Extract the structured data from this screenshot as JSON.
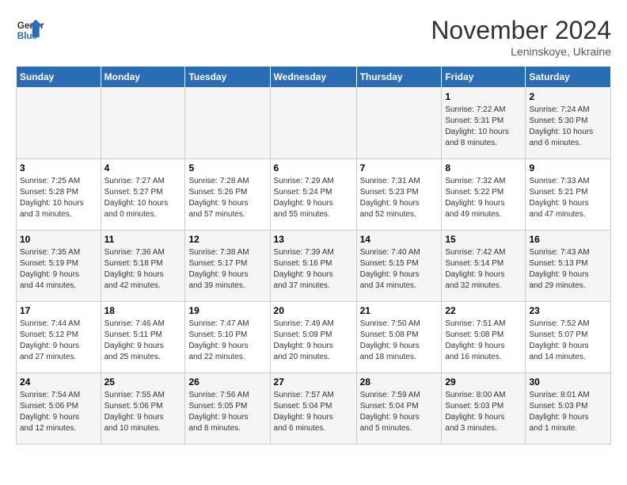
{
  "header": {
    "logo_text1": "General",
    "logo_text2": "Blue",
    "month": "November 2024",
    "location": "Leninskoye, Ukraine"
  },
  "weekdays": [
    "Sunday",
    "Monday",
    "Tuesday",
    "Wednesday",
    "Thursday",
    "Friday",
    "Saturday"
  ],
  "weeks": [
    [
      {
        "day": "",
        "info": ""
      },
      {
        "day": "",
        "info": ""
      },
      {
        "day": "",
        "info": ""
      },
      {
        "day": "",
        "info": ""
      },
      {
        "day": "",
        "info": ""
      },
      {
        "day": "1",
        "info": "Sunrise: 7:22 AM\nSunset: 5:31 PM\nDaylight: 10 hours\nand 8 minutes."
      },
      {
        "day": "2",
        "info": "Sunrise: 7:24 AM\nSunset: 5:30 PM\nDaylight: 10 hours\nand 6 minutes."
      }
    ],
    [
      {
        "day": "3",
        "info": "Sunrise: 7:25 AM\nSunset: 5:28 PM\nDaylight: 10 hours\nand 3 minutes."
      },
      {
        "day": "4",
        "info": "Sunrise: 7:27 AM\nSunset: 5:27 PM\nDaylight: 10 hours\nand 0 minutes."
      },
      {
        "day": "5",
        "info": "Sunrise: 7:28 AM\nSunset: 5:26 PM\nDaylight: 9 hours\nand 57 minutes."
      },
      {
        "day": "6",
        "info": "Sunrise: 7:29 AM\nSunset: 5:24 PM\nDaylight: 9 hours\nand 55 minutes."
      },
      {
        "day": "7",
        "info": "Sunrise: 7:31 AM\nSunset: 5:23 PM\nDaylight: 9 hours\nand 52 minutes."
      },
      {
        "day": "8",
        "info": "Sunrise: 7:32 AM\nSunset: 5:22 PM\nDaylight: 9 hours\nand 49 minutes."
      },
      {
        "day": "9",
        "info": "Sunrise: 7:33 AM\nSunset: 5:21 PM\nDaylight: 9 hours\nand 47 minutes."
      }
    ],
    [
      {
        "day": "10",
        "info": "Sunrise: 7:35 AM\nSunset: 5:19 PM\nDaylight: 9 hours\nand 44 minutes."
      },
      {
        "day": "11",
        "info": "Sunrise: 7:36 AM\nSunset: 5:18 PM\nDaylight: 9 hours\nand 42 minutes."
      },
      {
        "day": "12",
        "info": "Sunrise: 7:38 AM\nSunset: 5:17 PM\nDaylight: 9 hours\nand 39 minutes."
      },
      {
        "day": "13",
        "info": "Sunrise: 7:39 AM\nSunset: 5:16 PM\nDaylight: 9 hours\nand 37 minutes."
      },
      {
        "day": "14",
        "info": "Sunrise: 7:40 AM\nSunset: 5:15 PM\nDaylight: 9 hours\nand 34 minutes."
      },
      {
        "day": "15",
        "info": "Sunrise: 7:42 AM\nSunset: 5:14 PM\nDaylight: 9 hours\nand 32 minutes."
      },
      {
        "day": "16",
        "info": "Sunrise: 7:43 AM\nSunset: 5:13 PM\nDaylight: 9 hours\nand 29 minutes."
      }
    ],
    [
      {
        "day": "17",
        "info": "Sunrise: 7:44 AM\nSunset: 5:12 PM\nDaylight: 9 hours\nand 27 minutes."
      },
      {
        "day": "18",
        "info": "Sunrise: 7:46 AM\nSunset: 5:11 PM\nDaylight: 9 hours\nand 25 minutes."
      },
      {
        "day": "19",
        "info": "Sunrise: 7:47 AM\nSunset: 5:10 PM\nDaylight: 9 hours\nand 22 minutes."
      },
      {
        "day": "20",
        "info": "Sunrise: 7:49 AM\nSunset: 5:09 PM\nDaylight: 9 hours\nand 20 minutes."
      },
      {
        "day": "21",
        "info": "Sunrise: 7:50 AM\nSunset: 5:08 PM\nDaylight: 9 hours\nand 18 minutes."
      },
      {
        "day": "22",
        "info": "Sunrise: 7:51 AM\nSunset: 5:08 PM\nDaylight: 9 hours\nand 16 minutes."
      },
      {
        "day": "23",
        "info": "Sunrise: 7:52 AM\nSunset: 5:07 PM\nDaylight: 9 hours\nand 14 minutes."
      }
    ],
    [
      {
        "day": "24",
        "info": "Sunrise: 7:54 AM\nSunset: 5:06 PM\nDaylight: 9 hours\nand 12 minutes."
      },
      {
        "day": "25",
        "info": "Sunrise: 7:55 AM\nSunset: 5:06 PM\nDaylight: 9 hours\nand 10 minutes."
      },
      {
        "day": "26",
        "info": "Sunrise: 7:56 AM\nSunset: 5:05 PM\nDaylight: 9 hours\nand 8 minutes."
      },
      {
        "day": "27",
        "info": "Sunrise: 7:57 AM\nSunset: 5:04 PM\nDaylight: 9 hours\nand 6 minutes."
      },
      {
        "day": "28",
        "info": "Sunrise: 7:59 AM\nSunset: 5:04 PM\nDaylight: 9 hours\nand 5 minutes."
      },
      {
        "day": "29",
        "info": "Sunrise: 8:00 AM\nSunset: 5:03 PM\nDaylight: 9 hours\nand 3 minutes."
      },
      {
        "day": "30",
        "info": "Sunrise: 8:01 AM\nSunset: 5:03 PM\nDaylight: 9 hours\nand 1 minute."
      }
    ]
  ]
}
